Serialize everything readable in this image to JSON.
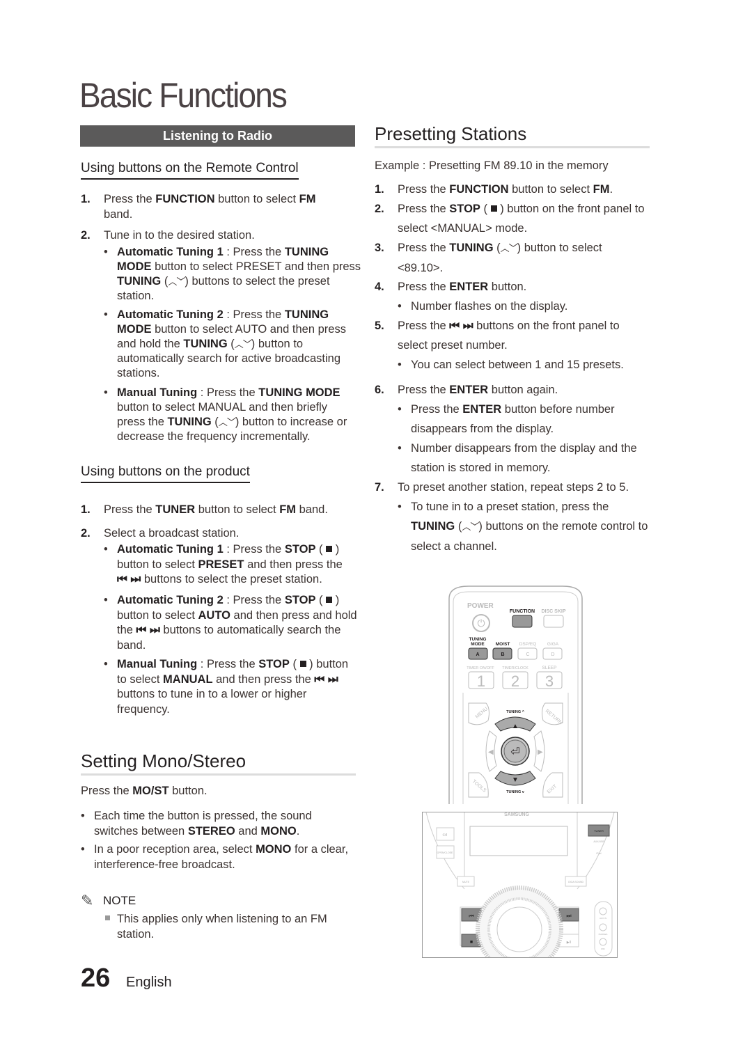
{
  "page": {
    "title": "Basic Functions",
    "page_number": "26",
    "language": "English"
  },
  "listening_to_radio": {
    "bar_label": "Listening to Radio",
    "remote_section": {
      "heading": "Using buttons on the Remote Control",
      "steps": [
        {
          "num": "1.",
          "lines": [
            "Press the <b>FUNCTION</b> button to select <b>FM</b>",
            "band."
          ]
        },
        {
          "num": "2.",
          "lines": [
            "Tune in to the desired station."
          ]
        }
      ],
      "bullets": [
        {
          "lines": [
            "<b>Automatic Tuning 1</b> : Press the <b>TUNING</b>",
            "<b>MODE</b> button to select PRESET and then press",
            "<b>TUNING</b> (<span class='chev'>︿﹀</span>) buttons to select the preset",
            "station."
          ]
        },
        {
          "lines": [
            "<b>Automatic Tuning 2</b> : Press the <b>TUNING</b>",
            "<b>MODE</b> button to select AUTO and then press",
            "and hold the <b>TUNING</b> (<span class='chev'>︿﹀</span>) button to",
            "automatically search for active broadcasting",
            "stations."
          ]
        },
        {
          "lines": [
            "<b>Manual Tuning</b> : Press the <b>TUNING MODE</b>",
            "button to select MANUAL and then briefly",
            "press the <b>TUNING</b> (<span class='chev'>︿﹀</span>) button to increase or",
            "decrease the frequency incrementally."
          ]
        }
      ]
    },
    "product_section": {
      "heading": "Using buttons on the product",
      "steps": [
        {
          "num": "1.",
          "lines": [
            "Press the <b>TUNER</b> button to select <b>FM</b> band."
          ]
        },
        {
          "num": "2.",
          "lines": [
            "Select a broadcast station."
          ]
        }
      ],
      "bullets": [
        {
          "lines": [
            "<b>Automatic Tuning 1</b> : Press the <b>STOP</b> ( <span class='sq'></span> )",
            "button to select <b>PRESET</b> and then press the",
            "<b>⏮ ⏭</b> buttons to select the preset station."
          ]
        },
        {
          "lines": [
            "<b>Automatic Tuning 2</b> : Press the <b>STOP</b> ( <span class='sq'></span> )",
            "button to select <b>AUTO</b> and then press and hold",
            "the <b>⏮ ⏭</b> buttons to automatically search the",
            "band."
          ]
        },
        {
          "lines": [
            "<b>Manual Tuning</b> : Press the <b>STOP</b> ( <span class='sq'></span> ) button",
            "to select <b>MANUAL</b> and then press the <b>⏮ ⏭</b>",
            "buttons to tune in to a lower or higher",
            "frequency."
          ]
        }
      ]
    }
  },
  "mono_stereo": {
    "heading": "Setting Mono/Stereo",
    "intro": "Press the <b>MO/ST</b> button.",
    "bullets": [
      {
        "lines": [
          "Each time the button is pressed, the sound",
          "switches between <b>STEREO</b> and <b>MONO</b>."
        ]
      },
      {
        "lines": [
          "In a poor reception area, select <b>MONO</b> for a clear,",
          "interference-free broadcast."
        ]
      }
    ],
    "note_label": "NOTE",
    "note_icon": "pencil-note-icon",
    "note_lines": [
      "This applies only when listening to an FM",
      "station."
    ]
  },
  "presetting": {
    "heading": "Presetting Stations",
    "example": "Example : Presetting FM 89.10 in the memory",
    "items": [
      {
        "type": "step",
        "num": "1.",
        "lines": [
          "Press the <b>FUNCTION</b> button to select <b>FM</b>."
        ]
      },
      {
        "type": "step",
        "num": "2.",
        "lines": [
          "Press the <b>STOP</b> ( <span class='sq'></span> ) button on the front panel to",
          "select &lt;MANUAL&gt; mode."
        ]
      },
      {
        "type": "step",
        "num": "3.",
        "lines": [
          "Press the <b>TUNING</b> (<span class='chev'>︿﹀</span>) button to select",
          "&lt;89.10&gt;."
        ]
      },
      {
        "type": "step",
        "num": "4.",
        "lines": [
          "Press the <b>ENTER</b> button."
        ]
      },
      {
        "type": "bullet",
        "lines": [
          "Number flashes on the display."
        ]
      },
      {
        "type": "step",
        "num": "5.",
        "lines": [
          "Press the <b>⏮ ⏭</b> buttons on the front panel to",
          "select preset number."
        ]
      },
      {
        "type": "bullet",
        "lines": [
          "You can select between 1 and 15 presets."
        ]
      },
      {
        "type": "step",
        "num": "6.",
        "lines": [
          "Press the <b>ENTER</b> button again."
        ]
      },
      {
        "type": "bullet",
        "lines": [
          "Press the <b>ENTER</b> button before number",
          "disappears from the display."
        ]
      },
      {
        "type": "bullet",
        "lines": [
          "Number disappears from the display and the",
          "station is stored in memory."
        ]
      },
      {
        "type": "step",
        "num": "7.",
        "lines": [
          "To preset another station, repeat steps 2 to 5."
        ]
      },
      {
        "type": "bullet",
        "lines": [
          "To tune in to a preset station, press the",
          "<b>TUNING</b> (<span class='chev'>︿﹀</span>) buttons on the remote control to",
          "select a channel."
        ]
      }
    ]
  },
  "remote": {
    "power": "POWER",
    "function": "FUNCTION",
    "disc_skip": "DISC SKIP",
    "tuning_mode": "TUNING MODE",
    "most": "MO/ST",
    "dsp": "DSP/EQ",
    "giga": "GIGA",
    "a": "A",
    "b": "B",
    "c": "C",
    "d": "D",
    "timer_onoff": "TIMER ON/OFF",
    "timer_clock": "TIMER/CLOCK",
    "sleep": "SLEEP",
    "n1": "1",
    "n2": "2",
    "n3": "3",
    "menu": "MENU",
    "return": "RETURN",
    "tools": "TOOLS",
    "exit": "EXIT",
    "tuning_up": "TUNING ^",
    "tuning_down": "TUNING v"
  },
  "device": {
    "brand": "SAMSUNG",
    "power": "⏻/I",
    "open_close": "OPEN/CLOSE",
    "tuner": "TUNER",
    "aux_usb": "AUX/USB",
    "ipod": "iPod",
    "mute": "MUTE",
    "giga": "GIGA SOUND",
    "prev": "⏮",
    "next": "⏭",
    "stop": "■",
    "play": "▶II",
    "aux_in": "AUX IN",
    "phones": "PHONES",
    "mic": "MIC"
  }
}
